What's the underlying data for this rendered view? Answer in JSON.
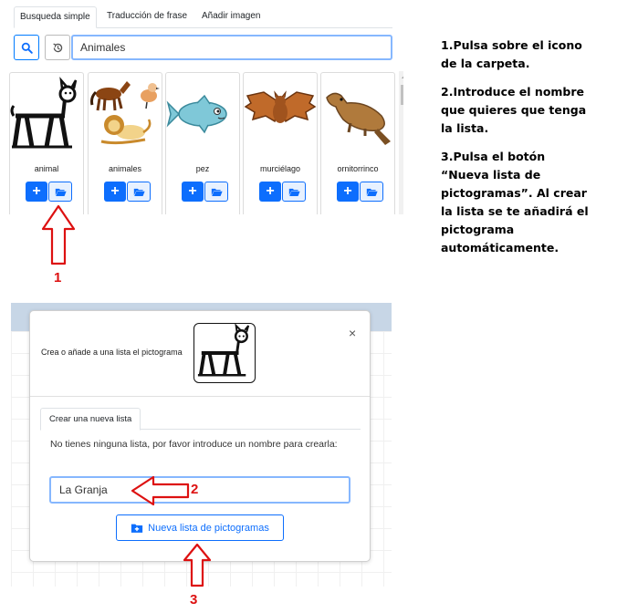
{
  "search_panel": {
    "tabs": [
      "Busqueda simple",
      "Traducción de frase",
      "Añadir imagen"
    ],
    "search_value": "Animales",
    "results": [
      {
        "label": "animal"
      },
      {
        "label": "animales"
      },
      {
        "label": "pez"
      },
      {
        "label": "murciélago"
      },
      {
        "label": "ornitorrinco"
      }
    ],
    "add_label": "+"
  },
  "steps": {
    "one": "1",
    "two": "2",
    "three": "3"
  },
  "instructions": [
    "1.Pulsa sobre el icono de la carpeta.",
    "2.Introduce el nombre que quieres que tenga la lista.",
    "3.Pulsa el botón “Nueva lista de pictogramas”. Al crear la lista se te añadirá el pictograma automáticamente."
  ],
  "modal": {
    "title": "Crea o añade a una lista el pictograma",
    "close": "×",
    "tab": "Crear una nueva lista",
    "help_text": "No tienes ninguna lista, por favor introduce un nombre para crearla:",
    "list_name_value": "La Granja",
    "new_list_button": "Nueva lista de pictogramas"
  },
  "colors": {
    "primary": "#0d6efd",
    "annotation_red": "#dd1111"
  }
}
